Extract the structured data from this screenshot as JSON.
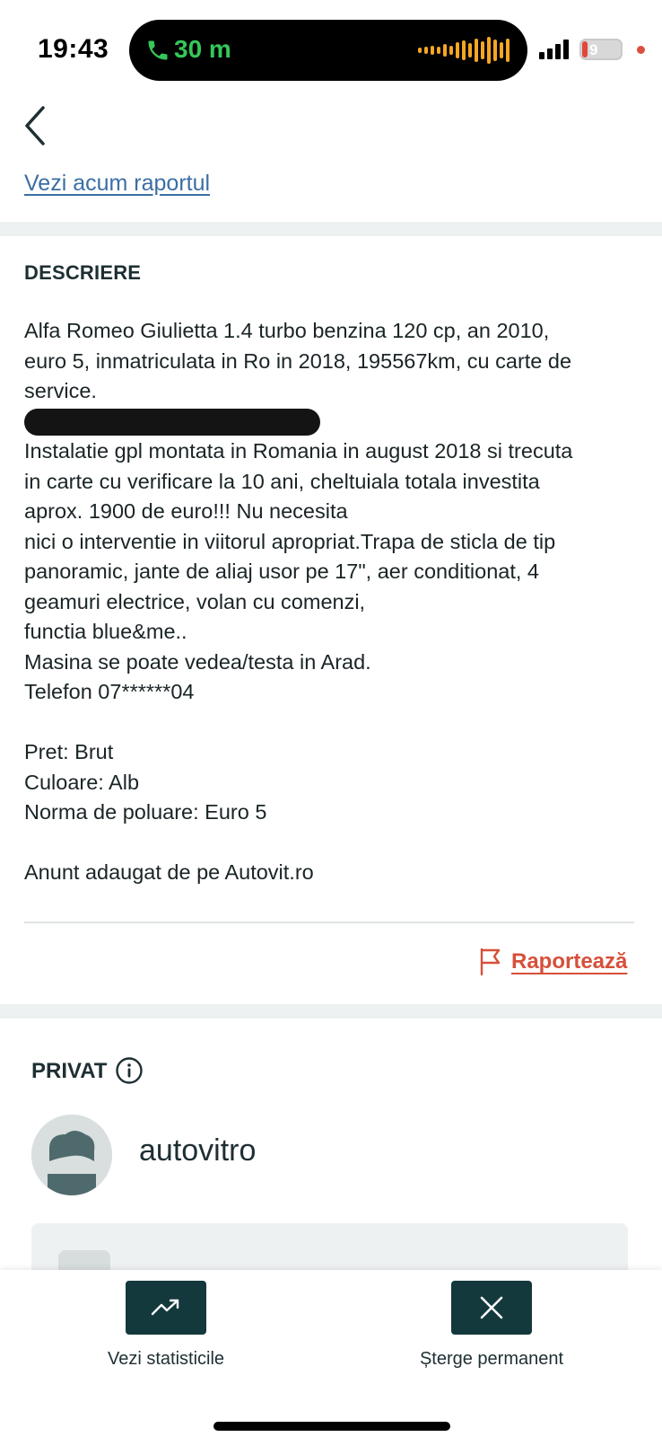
{
  "status_bar": {
    "time": "19:43",
    "call_duration": "30 m",
    "battery": "9"
  },
  "header": {
    "back_icon": "chevron-left-icon",
    "report_link": "Vezi acum raportul"
  },
  "description": {
    "heading": "DESCRIERE",
    "lines": [
      "Alfa Romeo Giulietta 1.4 turbo benzina 120 cp, an 2010,",
      "euro 5, inmatriculata in Ro in 2018, 195567km, cu carte de",
      "service.",
      "",
      "Instalatie gpl montata in Romania in august 2018 si trecuta",
      "in carte cu verificare la 10 ani, cheltuiala totala investita",
      "aprox. 1900 de euro!!! Nu necesita",
      "nici o interventie in viitorul apropriat.Trapa de sticla de tip",
      "panoramic, jante de aliaj usor pe 17\", aer conditionat, 4",
      "geamuri electrice, volan cu comenzi,",
      "functia blue&me..",
      "Masina se poate vedea/testa in Arad.",
      "Telefon 07******04"
    ],
    "specs": [
      "Pret: Brut",
      "Culoare: Alb",
      "Norma de poluare: Euro 5"
    ],
    "source": "Anunt adaugat de pe Autovit.ro",
    "report_button": "Raportează"
  },
  "seller": {
    "type": "PRIVAT",
    "name": "autovitro"
  },
  "bottom_bar": {
    "stats_label": "Vezi statisticile",
    "delete_label": "Șterge permanent"
  },
  "colors": {
    "primary_dark": "#14393d",
    "link": "#3b6ea5",
    "report": "#d6503a",
    "divider": "#eef1f2"
  }
}
